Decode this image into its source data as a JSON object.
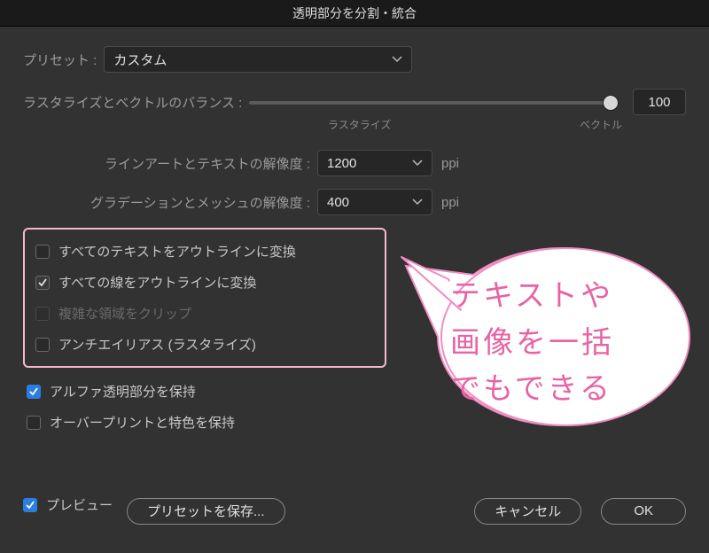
{
  "title": "透明部分を分割・統合",
  "preset": {
    "label": "プリセット :",
    "value": "カスタム"
  },
  "balance": {
    "label": "ラスタライズとベクトルのバランス :",
    "left": "ラスタライズ",
    "right": "ベクトル",
    "value": "100"
  },
  "resLine": {
    "label": "ラインアートとテキストの解像度 :",
    "value": "1200",
    "unit": "ppi"
  },
  "resGrad": {
    "label": "グラデーションとメッシュの解像度 :",
    "value": "400",
    "unit": "ppi"
  },
  "checks": {
    "textOutline": "すべてのテキストをアウトラインに変換",
    "strokeOutline": "すべての線をアウトラインに変換",
    "clipComplex": "複雑な領域をクリップ",
    "antialias": "アンチエイリアス (ラスタライズ)"
  },
  "lowerChecks": {
    "alpha": "アルファ透明部分を保持",
    "overprint": "オーバープリントと特色を保持"
  },
  "bottom": {
    "preview": "プレビュー",
    "savePreset": "プリセットを保存...",
    "cancel": "キャンセル",
    "ok": "OK"
  },
  "bubble": {
    "line1": "テキストや",
    "line2": "画像を一括",
    "line3": "でもできる"
  }
}
